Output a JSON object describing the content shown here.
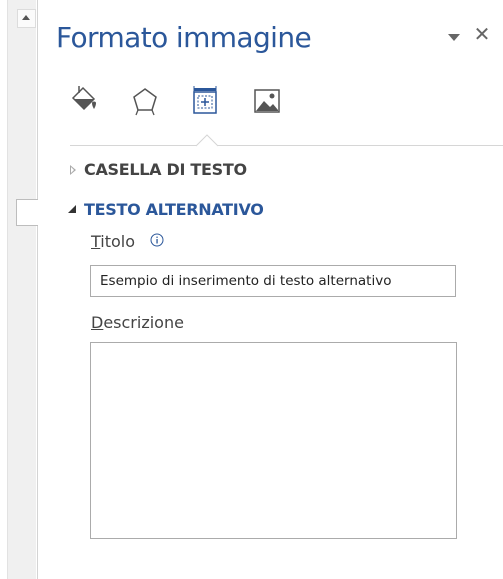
{
  "pane": {
    "title": "Formato immagine",
    "tabs": [
      "fill-line",
      "effects",
      "layout-properties",
      "picture"
    ],
    "active_tab": "layout-properties"
  },
  "sections": [
    {
      "label": "CASELLA DI TESTO",
      "expanded": false
    },
    {
      "label": "TESTO ALTERNATIVO",
      "expanded": true
    }
  ],
  "alt_text": {
    "title_label_accel": "T",
    "title_label_rest": "itolo",
    "title_value": "Esempio di inserimento di testo alternativo",
    "description_label_accel": "D",
    "description_label_rest": "escrizione",
    "description_value": ""
  },
  "icons": {
    "menu": "dropdown-triangle-icon",
    "close": "close-icon",
    "info": "info-icon"
  },
  "colors": {
    "accent": "#2b579a",
    "text": "#444444",
    "border": "#ababab"
  }
}
